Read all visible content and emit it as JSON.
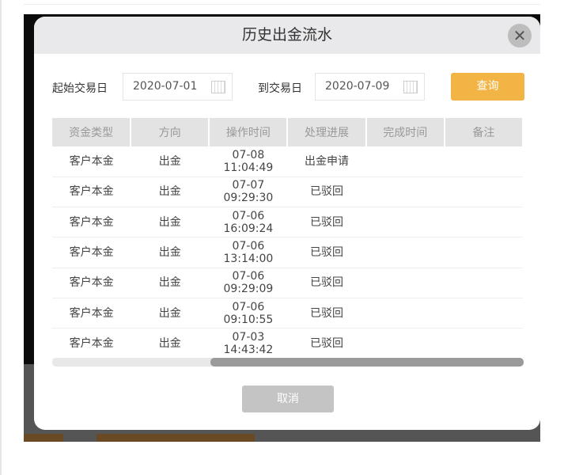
{
  "dialog": {
    "title": "历史出金流水",
    "close_icon": "close-icon"
  },
  "filter": {
    "start_label": "起始交易日",
    "start_value": "2020-07-01",
    "end_label": "到交易日",
    "end_value": "2020-07-09",
    "query_label": "查询"
  },
  "table": {
    "headers": [
      "资金类型",
      "方向",
      "操作时间",
      "处理进展",
      "完成时间",
      "备注"
    ],
    "rows": [
      {
        "type": "客户本金",
        "direction": "出金",
        "date": "07-08",
        "time": "11:04:49",
        "status": "出金申请",
        "done": "",
        "note": ""
      },
      {
        "type": "客户本金",
        "direction": "出金",
        "date": "07-07",
        "time": "09:29:30",
        "status": "已驳回",
        "done": "",
        "note": ""
      },
      {
        "type": "客户本金",
        "direction": "出金",
        "date": "07-06",
        "time": "16:09:24",
        "status": "已驳回",
        "done": "",
        "note": ""
      },
      {
        "type": "客户本金",
        "direction": "出金",
        "date": "07-06",
        "time": "13:14:00",
        "status": "已驳回",
        "done": "",
        "note": ""
      },
      {
        "type": "客户本金",
        "direction": "出金",
        "date": "07-06",
        "time": "09:29:09",
        "status": "已驳回",
        "done": "",
        "note": ""
      },
      {
        "type": "客户本金",
        "direction": "出金",
        "date": "07-06",
        "time": "09:10:55",
        "status": "已驳回",
        "done": "",
        "note": ""
      },
      {
        "type": "客户本金",
        "direction": "出金",
        "date": "07-03",
        "time": "14:43:42",
        "status": "已驳回",
        "done": "",
        "note": ""
      }
    ]
  },
  "footer": {
    "cancel_label": "取消"
  }
}
